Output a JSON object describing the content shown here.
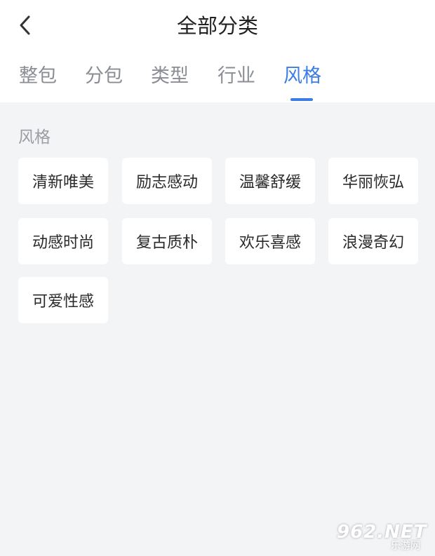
{
  "header": {
    "title": "全部分类",
    "back_icon": "chevron-left-icon"
  },
  "tabs": [
    {
      "label": "整包",
      "active": false
    },
    {
      "label": "分包",
      "active": false
    },
    {
      "label": "类型",
      "active": false
    },
    {
      "label": "行业",
      "active": false
    },
    {
      "label": "风格",
      "active": true
    }
  ],
  "section": {
    "label": "风格",
    "chips": [
      "清新唯美",
      "励志感动",
      "温馨舒缓",
      "华丽恢弘",
      "动感时尚",
      "复古质朴",
      "欢乐喜感",
      "浪漫奇幻",
      "可爱性感"
    ]
  },
  "watermark": {
    "logo": "962.NET",
    "sub": "乐游网"
  },
  "colors": {
    "accent": "#3b7ce5",
    "background": "#f3f4f6",
    "tab_inactive": "#8a8d93"
  }
}
